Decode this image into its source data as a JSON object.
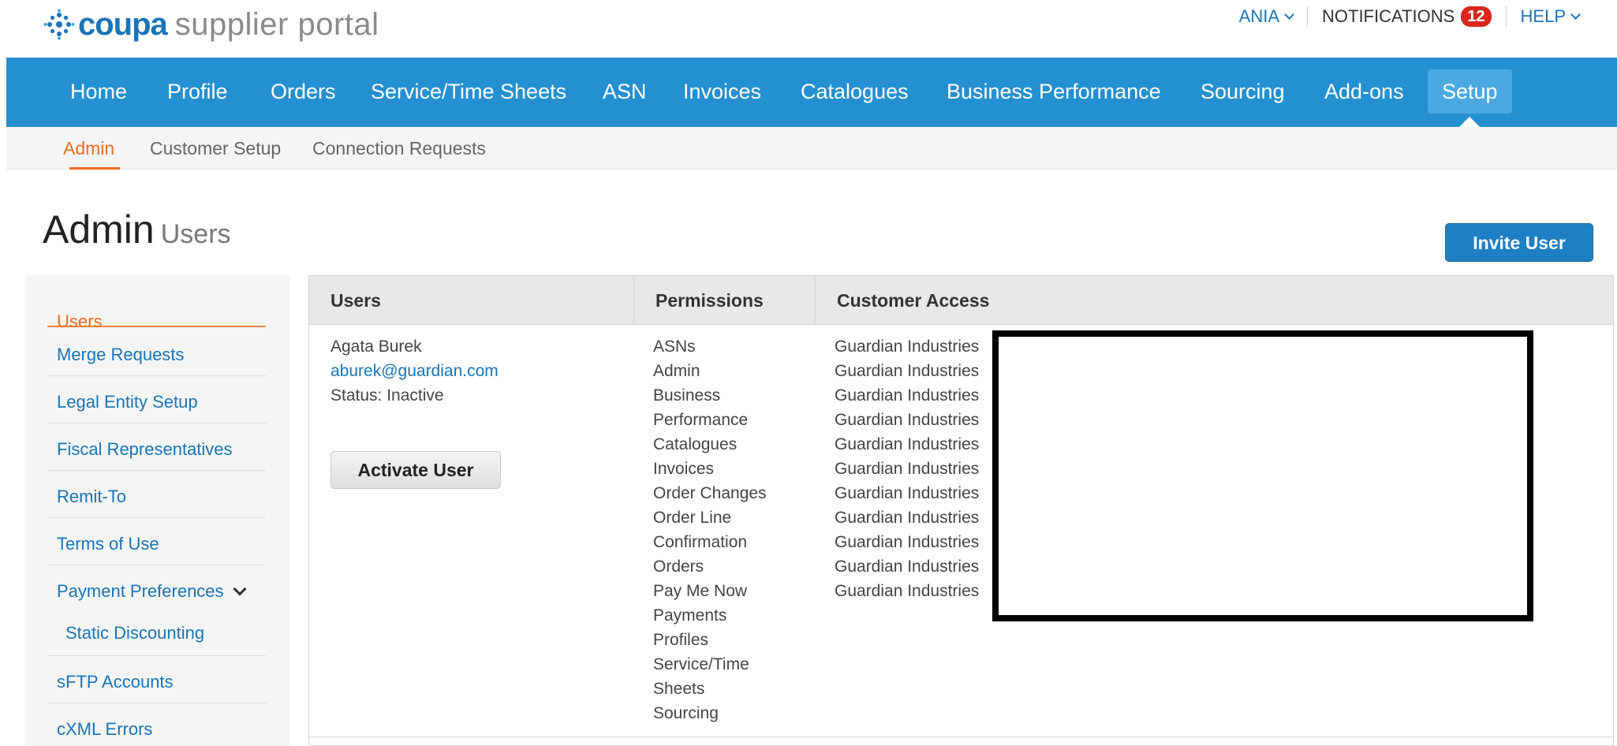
{
  "header": {
    "logo_brand": "coupa",
    "logo_rest": "supplier portal",
    "user_menu": "ANIA",
    "notifications_label": "NOTIFICATIONS",
    "notifications_count": "12",
    "help_label": "HELP"
  },
  "main_nav": {
    "items": [
      "Home",
      "Profile",
      "Orders",
      "Service/Time Sheets",
      "ASN",
      "Invoices",
      "Catalogues",
      "Business Performance",
      "Sourcing",
      "Add-ons",
      "Setup"
    ],
    "active": "Setup"
  },
  "sub_nav": {
    "items": [
      "Admin",
      "Customer Setup",
      "Connection Requests"
    ],
    "active": "Admin"
  },
  "page": {
    "title": "Admin",
    "subtitle": "Users",
    "invite_button": "Invite User"
  },
  "sidebar": {
    "items": [
      "Users",
      "Merge Requests",
      "Legal Entity Setup",
      "Fiscal Representatives",
      "Remit-To",
      "Terms of Use",
      "Payment Preferences",
      "Static Discounting",
      "sFTP Accounts",
      "cXML Errors"
    ],
    "active": "Users"
  },
  "table": {
    "headers": [
      "Users",
      "Permissions",
      "Customer Access"
    ],
    "rows": [
      {
        "name": "Agata Burek",
        "email": "aburek@guardian.com",
        "status": "Status: Inactive",
        "action": "Activate User",
        "permissions": [
          "ASNs",
          "Admin",
          "Business",
          "Performance",
          "Catalogues",
          "Invoices",
          "Order Changes",
          "Order Line",
          "Confirmation",
          "Orders",
          "Pay Me Now",
          "Payments",
          "Profiles",
          "Service/Time",
          "Sheets",
          "Sourcing"
        ],
        "customer_access": [
          "Guardian Industries",
          "Guardian Industries",
          "Guardian Industries",
          "Guardian Industries",
          "Guardian Industries",
          "Guardian Industries",
          "Guardian Industries",
          "Guardian Industries",
          "Guardian Industries",
          "Guardian Industries",
          "Guardian Industries"
        ]
      }
    ]
  },
  "colors": {
    "nav_blue": "#2590d1",
    "link_blue": "#1a74b8",
    "accent_orange": "#f06d1e",
    "badge_red": "#d9271d"
  }
}
